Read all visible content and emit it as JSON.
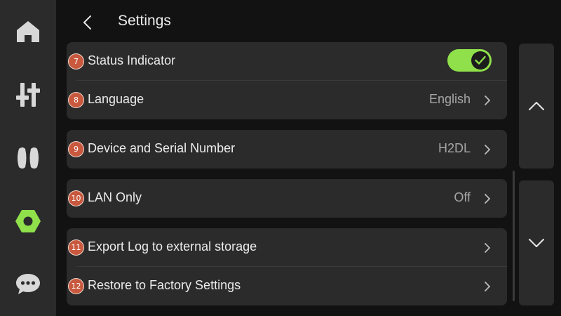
{
  "sidebar": {
    "items": [
      {
        "icon": "home-icon"
      },
      {
        "icon": "sliders-icon"
      },
      {
        "icon": "filament-spool-icon"
      },
      {
        "icon": "settings-hex-icon",
        "active": true
      },
      {
        "icon": "chat-icon"
      }
    ],
    "active_color": "#8fe04a"
  },
  "header": {
    "title": "Settings"
  },
  "settings": {
    "rows": [
      {
        "badge": "7",
        "label": "Status Indicator",
        "value": "",
        "control": "toggle",
        "toggle_on": true
      },
      {
        "badge": "8",
        "label": "Language",
        "value": "English",
        "control": "chevron"
      },
      {
        "badge": "9",
        "label": "Device and Serial Number",
        "value": "H2DL",
        "control": "chevron"
      },
      {
        "badge": "10",
        "label": "LAN Only",
        "value": "Off",
        "control": "chevron"
      },
      {
        "badge": "11",
        "label": "Export Log to external storage",
        "value": "",
        "control": "chevron"
      },
      {
        "badge": "12",
        "label": "Restore to Factory Settings",
        "value": "",
        "control": "chevron"
      }
    ]
  },
  "scroll": {
    "up_icon": "chevron-up-icon",
    "down_icon": "chevron-down-icon"
  },
  "colors": {
    "accent": "#8fe04a",
    "badge": "#c8593f",
    "card": "#2b2b2b",
    "background": "#121212"
  }
}
